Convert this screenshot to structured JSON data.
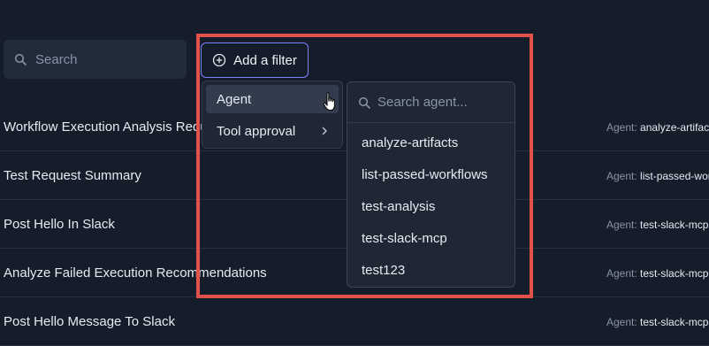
{
  "search": {
    "placeholder": "Search"
  },
  "add_filter": {
    "label": "Add a filter"
  },
  "rows": [
    {
      "title": "Workflow Execution Analysis Request",
      "agent_label": "Agent:",
      "agent": "analyze-artifacts"
    },
    {
      "title": "Test Request Summary",
      "agent_label": "Agent:",
      "agent": "list-passed-workflows"
    },
    {
      "title": "Post Hello In Slack",
      "agent_label": "Agent:",
      "agent": "test-slack-mcp"
    },
    {
      "title": "Analyze Failed Execution Recommendations",
      "agent_label": "Agent:",
      "agent": "test-slack-mcp"
    },
    {
      "title": "Post Hello Message To Slack",
      "agent_label": "Agent:",
      "agent": "test-slack-mcp"
    }
  ],
  "filter_menu": {
    "items": [
      {
        "label": "Agent"
      },
      {
        "label": "Tool approval"
      }
    ]
  },
  "agent_submenu": {
    "placeholder": "Search agent...",
    "options": [
      "analyze-artifacts",
      "list-passed-workflows",
      "test-analysis",
      "test-slack-mcp",
      "test123"
    ]
  },
  "colors": {
    "background": "#161d2a",
    "accent_border": "#7a82ff",
    "highlight": "#e2514a",
    "muted_text": "#8a94a6"
  },
  "icons": [
    "search-icon",
    "plus-circle-icon",
    "chevron-right-icon",
    "hand-pointer-cursor-icon"
  ]
}
